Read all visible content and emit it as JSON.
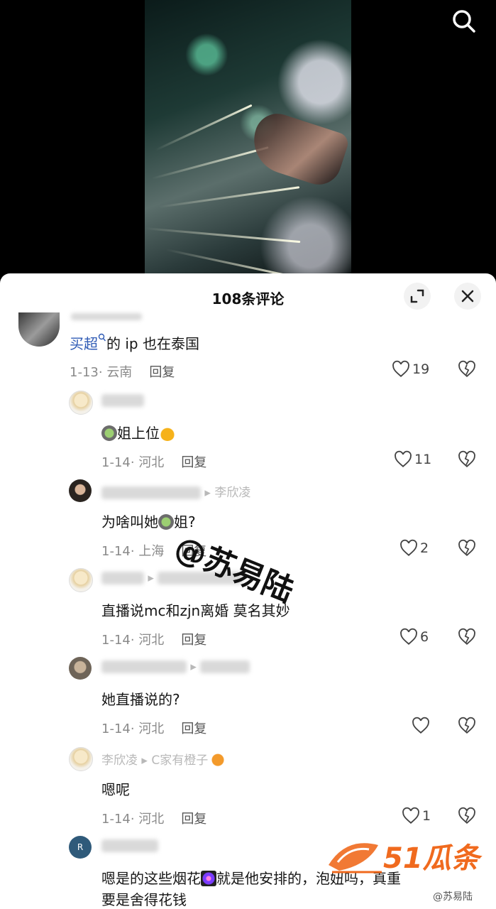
{
  "header": {
    "title": "108条评论"
  },
  "comments": [
    {
      "text_mention": "买超",
      "text_rest": "的 ip 也在泰国",
      "date": "1-13",
      "location": "云南",
      "reply": "回复",
      "likes": "19"
    },
    {
      "text_pre": "",
      "text_main": "姐上位",
      "date": "1-14",
      "location": "河北",
      "reply": "回复",
      "likes": "11"
    },
    {
      "reply_to": "李欣凌",
      "text_pre": "为啥叫她",
      "text_post": "姐?",
      "date": "1-14",
      "location": "上海",
      "reply": "回复",
      "likes": "2"
    },
    {
      "text": "直播说mc和zjn离婚 莫名其妙",
      "date": "1-14",
      "location": "河北",
      "reply": "回复",
      "likes": "6"
    },
    {
      "text": "她直播说的?",
      "date": "1-14",
      "location": "河北",
      "reply": "回复",
      "likes": ""
    },
    {
      "name": "李欣凌",
      "reply_to": "C家有橙子",
      "text": "嗯呢",
      "date": "1-14",
      "location": "河北",
      "reply": "回复",
      "likes": "1"
    },
    {
      "text_pre": "嗯是的这些烟花",
      "text_post": "就是他安排的，泡妞吗，真重",
      "text_line2": "要是舍得花钱"
    }
  ],
  "watermark": "@苏易陆",
  "logo": {
    "text": "51瓜条"
  },
  "credit": "@苏易陆",
  "icons": [
    "search-icon",
    "expand-icon",
    "close-icon",
    "heart-icon",
    "broken-heart-icon"
  ]
}
